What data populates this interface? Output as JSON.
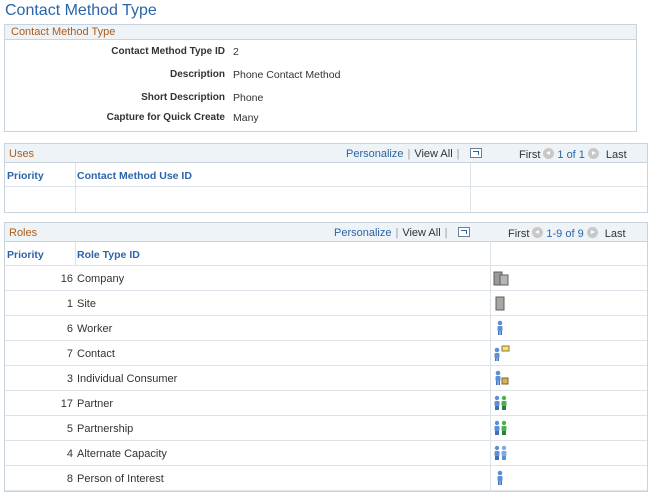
{
  "page": {
    "title": "Contact Method Type"
  },
  "detail": {
    "header": "Contact Method Type",
    "fields": [
      {
        "label": "Contact Method Type ID",
        "value": "2"
      },
      {
        "label": "Description",
        "value": "Phone Contact Method"
      },
      {
        "label": "Short Description",
        "value": "Phone"
      },
      {
        "label": "Capture for Quick Create",
        "value": "Many"
      }
    ]
  },
  "uses": {
    "title": "Uses",
    "personalize": "Personalize",
    "view_all": "View All",
    "first": "First",
    "range": "1 of 1",
    "last": "Last",
    "columns": [
      "Priority",
      "Contact Method Use ID"
    ]
  },
  "roles": {
    "title": "Roles",
    "personalize": "Personalize",
    "view_all": "View All",
    "first": "First",
    "range": "1-9 of 9",
    "last": "Last",
    "columns": [
      "Priority",
      "Role Type ID"
    ],
    "rows": [
      {
        "priority": "16",
        "name": "Company",
        "icon": "company-building-icon"
      },
      {
        "priority": "1",
        "name": "Site",
        "icon": "site-building-icon"
      },
      {
        "priority": "6",
        "name": "Worker",
        "icon": "worker-person-icon"
      },
      {
        "priority": "7",
        "name": "Contact",
        "icon": "contact-person-icon"
      },
      {
        "priority": "3",
        "name": "Individual Consumer",
        "icon": "consumer-person-icon"
      },
      {
        "priority": "17",
        "name": "Partner",
        "icon": "partner-people-icon"
      },
      {
        "priority": "5",
        "name": "Partnership",
        "icon": "partnership-people-icon"
      },
      {
        "priority": "4",
        "name": "Alternate Capacity",
        "icon": "alternate-capacity-icon"
      },
      {
        "priority": "8",
        "name": "Person of Interest",
        "icon": "person-of-interest-icon"
      }
    ]
  },
  "colors": {
    "link": "#2b64a8",
    "section_title": "#b05b16",
    "header_bg": "#eef3f8",
    "border": "#c9d3de"
  }
}
